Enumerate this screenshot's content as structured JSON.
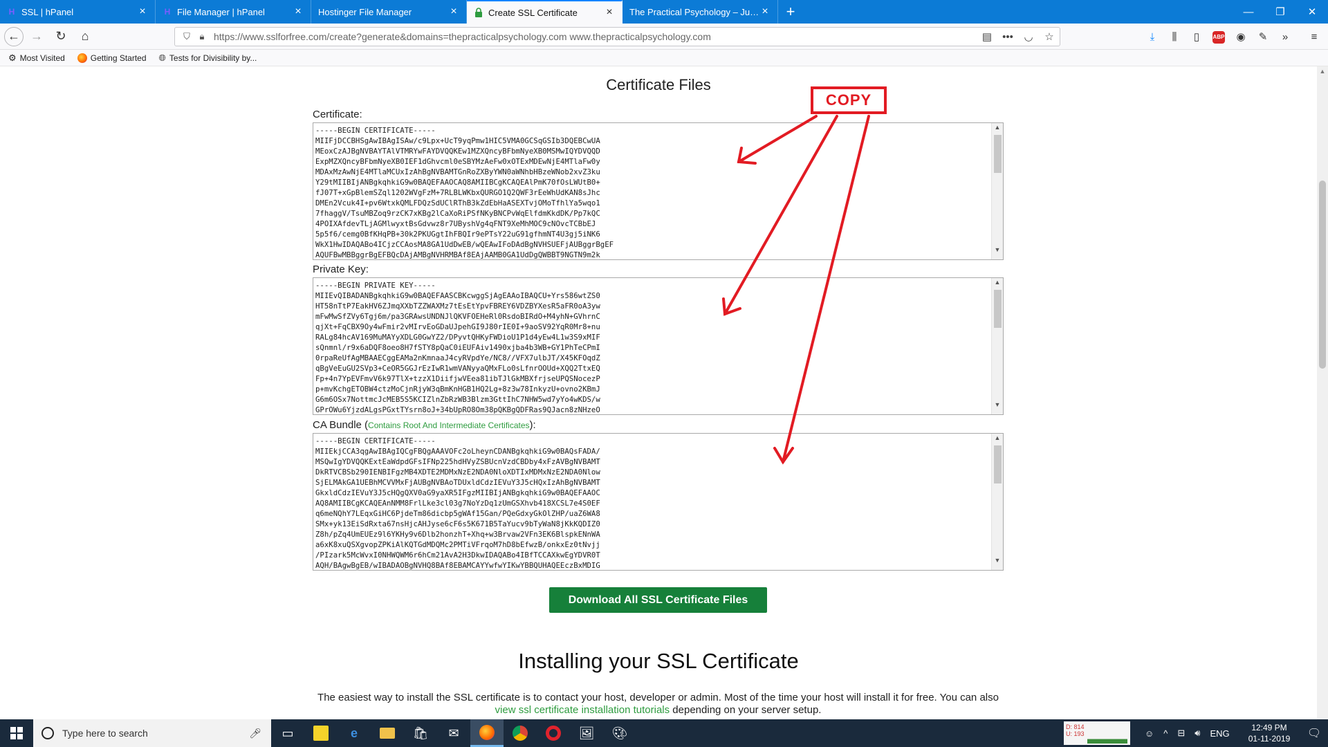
{
  "browser": {
    "tabs": [
      {
        "title": "SSL | hPanel",
        "favicon": "H",
        "active": false
      },
      {
        "title": "File Manager | hPanel",
        "favicon": "H",
        "active": false
      },
      {
        "title": "Hostinger File Manager",
        "favicon": "",
        "active": false
      },
      {
        "title": "Create SSL Certificate",
        "favicon": "lock",
        "active": true
      },
      {
        "title": "The Practical Psychology – Just and",
        "favicon": "",
        "active": false
      }
    ],
    "url": "https://www.sslforfree.com/create?generate&domains=thepracticalpsychology.com www.thepracticalpsychology.com",
    "bookmarks": [
      {
        "label": "Most Visited",
        "icon": "gear-icon"
      },
      {
        "label": "Getting Started",
        "icon": "firefox-icon"
      },
      {
        "label": "Tests for Divisibility by...",
        "icon": "globe-icon"
      }
    ]
  },
  "page": {
    "heading": "Certificate Files",
    "annotation": "COPY",
    "fields": {
      "certificate": {
        "label": "Certificate:",
        "lines": [
          "-----BEGIN CERTIFICATE-----",
          "MIIFjDCCBHSgAwIBAgISAw/c9Lpx+UcT9yqPmw1HIC5VMA0GCSqGSIb3DQEBCwUA",
          "MEoxCzAJBgNVBAYTAlVTMRYwFAYDVQQKEw1MZXQncyBFbmNyeXB0MSMwIQYDVQQD",
          "ExpMZXQncyBFbmNyeXB0IEF1dGhvcml0eSBYMzAeFw0xOTExMDEwNjE4MTlaFw0y",
          "MDAxMzAwNjE4MTlaMCUxIzAhBgNVBAMTGnRoZXByYWN0aWNhbHBzeWNob2xvZ3ku",
          "Y29tMIIBIjANBgkqhkiG9w0BAQEFAAOCAQ8AMIIBCgKCAQEAlPmK70fOsLWUtB0+",
          "fJ07T+xGpBlemSZql1202WVgFzM+7RLBLWKbxQURGO1Q2QWF3rEeWhUdKAN8sJhc",
          "DMEn2Vcuk4I+pv6WtxkQMLFDQzSdUClRThB3kZdEbHaASEXTvjOMoTfhlYa5wqo1",
          "7fhaggV/TsuMBZoq9rzCK7xKBg2lCaXoRiPSfNKyBNCPvWqElfdmKkdDK/Pp7kQC",
          "4POIXAfdevTLjAGMlwyxtBsGdvwz8r7UByshVg4qFNT9XeMhMOC9cNOvcTCBbEJ",
          "5p5f6/cemg0BfKHqPB+30k2PKUGgtIhFBQIr9ePTsY22uG91gfhmNT4U3gj5iNK6",
          "WkX1HwIDAQABo4ICjzCCAosMA8GA1UdDwEB/wQEAwIFoDAdBgNVHSUEFjAUBggrBgEF",
          "AQUFBwMBBggrBgEFBQcDAjAMBgNVHRMBAf8EAjAAMB0GA1UdDgQWBBT9NGTN9m2k"
        ]
      },
      "private_key": {
        "label": "Private Key:",
        "lines": [
          "-----BEGIN PRIVATE KEY-----",
          "MIIEvQIBADANBgkqhkiG9w0BAQEFAASCBKcwggSjAgEAAoIBAQCU+Yrs586wtZS0",
          "HT58nTtP7EakHV6ZJmqXXbTZZWAXMz7tEsEtYpvFBREY6VDZBYXesR5aFR0oA3yw",
          "mFwMwSfZVy6Tgj6m/pa3GRAwsUNDNJlQKVFOEHeRl0RsdoBIRdO+M4yhN+GVhrnC",
          "qjXt+FqCBX9Oy4wFmir2vMIrvEoGDaUJpehGI9J80rIE0I+9aoSV92YqR0Mr8+nu",
          "RALg84hcAV169MuMAYyXDLG0GwYZ2/DPyvtQHKyFWDioU1P1d4yEw4L1w3S9xMIF",
          "sQnmnl/r9x6aDQF8oeo8H7fSTY8pQaC0iEUFAiv1490xjba4b3WB+GY1PhTeCPmI",
          "0rpaReUfAgMBAAECggEAMa2nKmnaaJ4cyRVpdYe/NC8//VFX7ulbJT/X45KFOqdZ",
          "qBgVeEuGU2SVp3+CeOR5GGJrEzIwR1wmVANyyaQMxFLo0sLfnrOOUd+XQQ2TtxEQ",
          "Fp+4n7YpEVFmvV6k97TlX+tzzX1DiifjwVEea81ibTJlGkMBXfrjseUPQSNocezP",
          "p+mvKchgETOBW4ctzMoCjnRjyW3qBmKnHGB1HQ2Lg+8z3w78InkyzU+ovno2KBmJ",
          "G6m6OSx7NottmcJcMEB5S5KCIZlnZbRzWB3Blzm3GttIhC7NHW5wd7yYo4wKDS/w",
          "GPrOWu6YjzdALgsPGxtTYsrn8oJ+34bUpRO8Om38pQKBgQDFRas9QJacn8zNHzeO"
        ]
      },
      "ca_bundle": {
        "label_main": "CA Bundle (",
        "label_note": "Contains Root And Intermediate Certificates",
        "label_end": "):",
        "lines": [
          "-----BEGIN CERTIFICATE-----",
          "MIIEkjCCA3qgAwIBAgIQCgFBQgAAAVOFc2oLheynCDANBgkqhkiG9w0BAQsFADA/",
          "MSQwIgYDVQQKExtEaWdpdGFsIFNp225hdHVyZSBUcnVzdCBDby4xFzAVBgNVBAMT",
          "DkRTVCBSb290IENBIFgzMB4XDTE2MDMxNzE2NDA0NloXDTIxMDMxNzE2NDA0Nlow",
          "SjELMAkGA1UEBhMCVVMxFjAUBgNVBAoTDUxldCdzIEVuY3J5cHQxIzAhBgNVBAMT",
          "GkxldCdzIEVuY3J5cHQgQXV0aG9yaXR5IFgzMIIBIjANBgkqhkiG9w0BAQEFAAOC",
          "AQ8AMIIBCgKCAQEAnNMM8FrlLke3cl03g7NoYzDq1zUmGSXhvb418XCSL7e4S0EF",
          "q6meNQhY7LEqxGiHC6PjdeTm86dicbp5gWAf15Gan/PQeGdxyGkOlZHP/uaZ6WA8",
          "SMx+yk13EiSdRxta67nsHjcAHJyse6cF6s5K671B5TaYucv9bTyWaN8jKkKQDIZ0",
          "Z8h/pZq4UmEUEz9l6YKHy9v6Dlb2honzhT+Xhq+w3Brvaw2VFn3EK6BlspkENnWA",
          "a6xK8xuQSXgvopZPKiAlKQTGdMDQMc2PMTiVFrqoM7hD8bEfwzB/onkxEz0tNvjj",
          "/PIzark5McWvxI0NHWQWM6r6hCm21AvA2H3DkwIDAQABo4IBfTCCAXkwEgYDVR0T",
          "AQH/BAgwBgEB/wIBADAOBgNVHQ8BAf8EBAMCAYYwfwYIKwYBBQUHAQEEczBxMDIG"
        ]
      }
    },
    "download_button": "Download All SSL Certificate Files",
    "install": {
      "heading": "Installing your SSL Certificate",
      "text_before": "The easiest way to install the SSL certificate is to contact your host, developer or admin. Most of the time your host will install it for free. You can also ",
      "link": "view ssl certificate installation tutorials",
      "text_after": " depending on your server setup."
    }
  },
  "taskbar": {
    "search_placeholder": "Type here to search",
    "perf_d": "D: 814",
    "perf_u": "U: 193",
    "lang": "ENG",
    "time": "12:49 PM",
    "date": "01-11-2019"
  }
}
